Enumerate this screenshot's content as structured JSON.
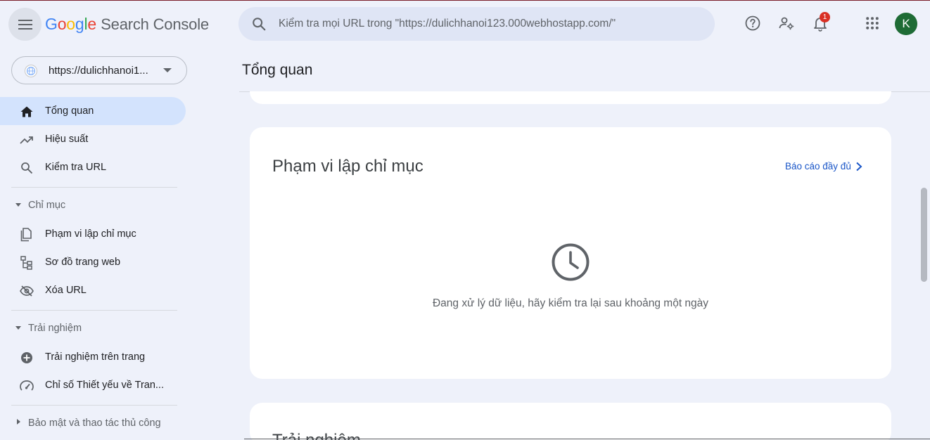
{
  "header": {
    "logo_brand": "Google",
    "logo_product": "Search Console",
    "search_placeholder": "Kiểm tra mọi URL trong \"https://dulichhanoi123.000webhostapp.com/\"",
    "notification_count": "1",
    "avatar_initial": "K"
  },
  "colors": {
    "google_blue": "#4285f4",
    "google_red": "#ea4335",
    "google_yellow": "#fbbc05",
    "google_green": "#34a853",
    "accent": "#1a56c8",
    "active_nav": "#d3e3fd",
    "avatar_bg": "#1e6b35",
    "badge": "#d93025"
  },
  "sidebar": {
    "property_label": "https://dulichhanoi1...",
    "items": [
      {
        "label": "Tổng quan",
        "icon": "home-icon",
        "active": true
      },
      {
        "label": "Hiệu suất",
        "icon": "trending-up-icon"
      },
      {
        "label": "Kiểm tra URL",
        "icon": "search-icon"
      }
    ],
    "sections": [
      {
        "label": "Chỉ mục",
        "expanded": true,
        "items": [
          {
            "label": "Phạm vi lập chỉ mục",
            "icon": "pages-icon"
          },
          {
            "label": "Sơ đồ trang web",
            "icon": "sitemap-icon"
          },
          {
            "label": "Xóa URL",
            "icon": "visibility-off-icon"
          }
        ]
      },
      {
        "label": "Trải nghiệm",
        "expanded": true,
        "items": [
          {
            "label": "Trải nghiệm trên trang",
            "icon": "add-circle-icon"
          },
          {
            "label": "Chỉ số Thiết yếu về Tran...",
            "icon": "speed-icon"
          }
        ]
      },
      {
        "label": "Bảo mật và thao tác thủ công",
        "expanded": false,
        "items": []
      }
    ]
  },
  "main": {
    "page_title": "Tổng quan",
    "coverage_card": {
      "title": "Phạm vi lập chỉ mục",
      "full_report_link": "Báo cáo đầy đủ",
      "processing_message": "Đang xử lý dữ liệu, hãy kiểm tra lại sau khoảng một ngày"
    },
    "experience_card": {
      "title": "Trải nghiệm"
    }
  }
}
